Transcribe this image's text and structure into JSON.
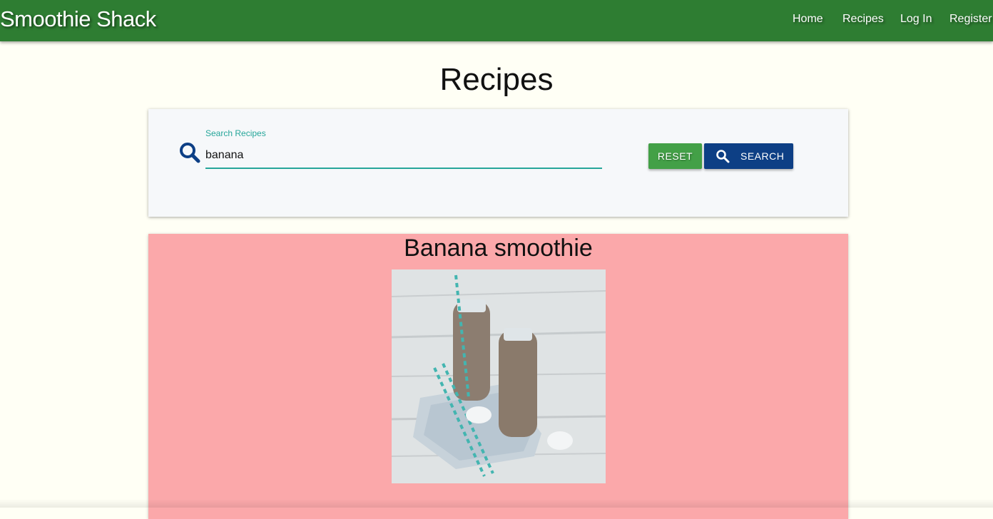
{
  "header": {
    "brand": "Smoothie Shack",
    "nav": {
      "home": "Home",
      "recipes": "Recipes",
      "login": "Log In",
      "register": "Register"
    }
  },
  "page": {
    "title": "Recipes"
  },
  "search": {
    "label": "Search Recipes",
    "value": "banana",
    "reset_label": "RESET",
    "search_label": "SEARCH"
  },
  "results": [
    {
      "title": "Banana smoothie",
      "image": "two glass bottles of banana smoothie with striped straws"
    }
  ],
  "colors": {
    "header_bg": "#2e7d32",
    "page_bg": "#fffff5",
    "accent_teal": "#26a69a",
    "reset_button": "#43a047",
    "search_button": "#0d3f85",
    "result_card_bg": "#fba8aa"
  }
}
